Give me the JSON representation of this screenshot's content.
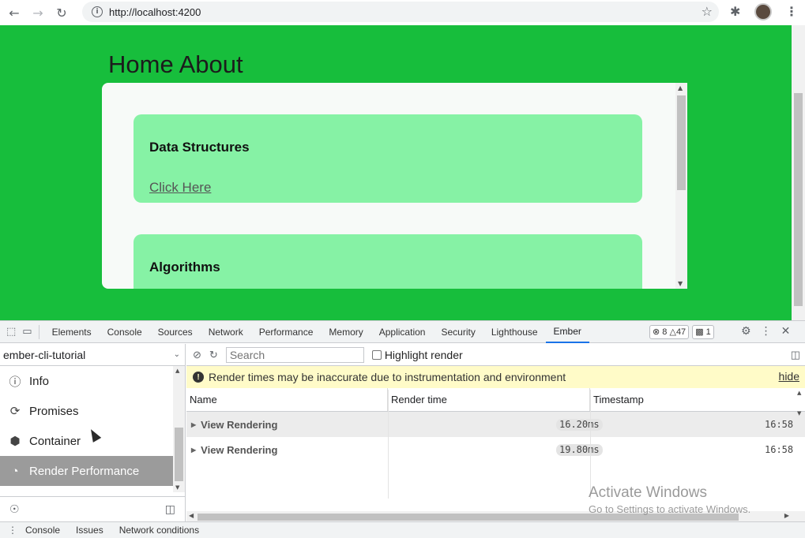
{
  "browser": {
    "url": "http://localhost:4200"
  },
  "page": {
    "title": "Home About",
    "cards": [
      {
        "title": "Data Structures",
        "link": "Click Here"
      },
      {
        "title": "Algorithms"
      }
    ],
    "colors": {
      "background": "#17be3c",
      "card": "#86f2a5"
    }
  },
  "devtools": {
    "tabs": [
      "Elements",
      "Console",
      "Sources",
      "Network",
      "Performance",
      "Memory",
      "Application",
      "Security",
      "Lighthouse",
      "Ember"
    ],
    "active_tab": "Ember",
    "badges": {
      "errors": "8",
      "warnings": "47",
      "messages": "1"
    },
    "app_name": "ember-cli-tutorial",
    "nav": [
      {
        "label": "Info",
        "icon": "info-icon"
      },
      {
        "label": "Promises",
        "icon": "promises-icon"
      },
      {
        "label": "Container",
        "icon": "container-icon"
      },
      {
        "label": "Render Performance",
        "icon": "gauge-icon"
      }
    ],
    "search_placeholder": "Search",
    "highlight_label": "Highlight render",
    "warning_text": "Render times may be inaccurate due to instrumentation and environment",
    "hide_label": "hide",
    "columns": [
      "Name",
      "Render time",
      "Timestamp"
    ],
    "rows": [
      {
        "name": "View Rendering",
        "render_time": "16.20ms",
        "timestamp": "16:58"
      },
      {
        "name": "View Rendering",
        "render_time": "19.80ms",
        "timestamp": "16:58"
      }
    ],
    "drawer_tabs": [
      "Console",
      "Issues",
      "Network conditions"
    ]
  },
  "watermark": {
    "line1": "Activate Windows",
    "line2": "Go to Settings to activate Windows."
  }
}
